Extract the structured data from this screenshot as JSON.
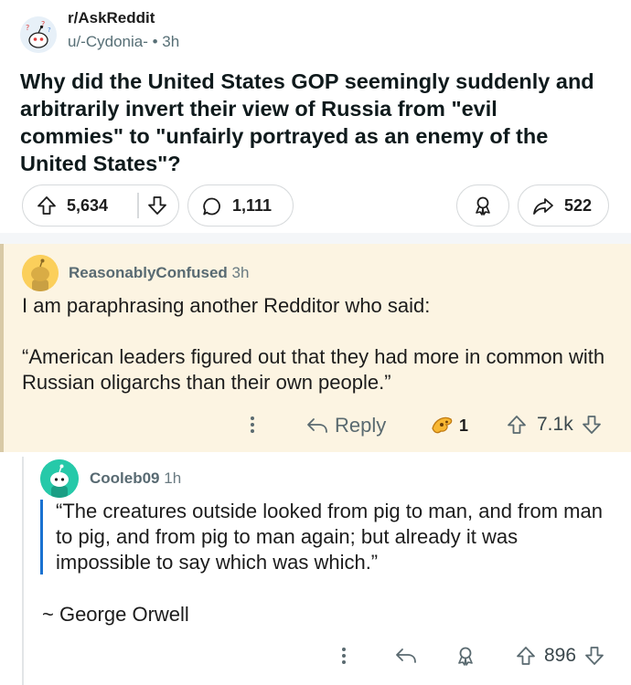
{
  "post": {
    "subreddit": "r/AskReddit",
    "author_meta": "u/-Cydonia- • 3h",
    "title": "Why did the United States GOP seemingly suddenly and arbitrarily invert their view of Russia from \"evil commies\" to \"unfairly portrayed as an enemy of the United States\"?",
    "vote_count": "5,634",
    "comment_count": "1,111",
    "share_count": "522"
  },
  "comments": [
    {
      "author": "ReasonablyConfused",
      "time": "3h",
      "body": [
        "I am paraphrasing another Redditor who said:",
        "“American leaders figured out that they had more in common with Russian oligarchs than their own people.”"
      ],
      "reply_label": "Reply",
      "award_count": "1",
      "vote_count": "7.1k"
    },
    {
      "author": "Cooleb09",
      "time": "1h",
      "quote": "“The creatures outside looked from pig to man, and from man to pig, and from pig to man again; but already it was impossible to say which was which.”",
      "signature": "~ George Orwell",
      "vote_count": "896"
    }
  ],
  "colors": {
    "highlight_bg": "#fcf4e2",
    "quote_bar": "#1a72d1",
    "avatar_yellow": "#fbcf5b",
    "avatar_teal": "#26c9a9"
  },
  "icons": [
    "upvote-icon",
    "downvote-icon",
    "comment-icon",
    "award-icon",
    "share-icon",
    "more-icon",
    "reply-icon"
  ]
}
